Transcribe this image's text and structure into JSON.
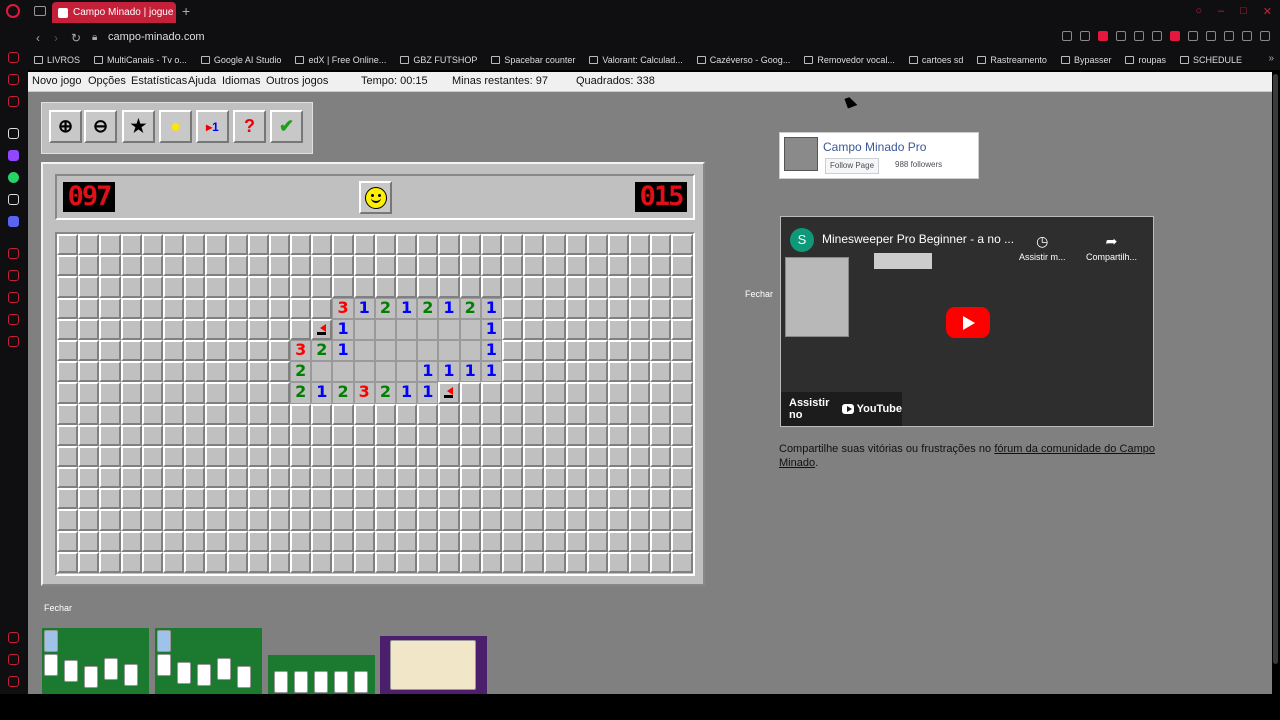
{
  "browser": {
    "tab_title": "Campo Minado | jogue on",
    "url": "campo-minado.com",
    "new_tab_symbol": "+",
    "bookmarks": [
      "LIVROS",
      "MultiCanais - Tv o...",
      "Google AI Studio",
      "edX | Free Online...",
      "GBZ FUTSHOP",
      "Spacebar counter",
      "Valorant: Calculad...",
      "Cazéverso - Goog...",
      "Removedor vocal...",
      "cartoes sd",
      "Rastreamento",
      "Bypasser",
      "roupas",
      "SCHEDULE"
    ]
  },
  "menu": {
    "items": [
      "Novo jogo",
      "Opções",
      "Estatísticas",
      "Ajuda",
      "Idiomas",
      "Outros jogos"
    ],
    "time_label": "Tempo: 00:15",
    "mines_label": "Minas restantes: 97",
    "squares_label": "Quadrados: 338"
  },
  "toolbar": {
    "icons": [
      "zoom-in-icon",
      "zoom-out-icon",
      "star-icon",
      "hint-bulb-icon",
      "flag-number-icon",
      "question-icon",
      "check-icon"
    ]
  },
  "game": {
    "mine_counter": "097",
    "timer": "015",
    "rows": 16,
    "cols": 30,
    "revealed": [
      {
        "r": 3,
        "c": 13,
        "v": "3"
      },
      {
        "r": 3,
        "c": 14,
        "v": "1"
      },
      {
        "r": 3,
        "c": 15,
        "v": "2"
      },
      {
        "r": 3,
        "c": 16,
        "v": "1"
      },
      {
        "r": 3,
        "c": 17,
        "v": "2"
      },
      {
        "r": 3,
        "c": 18,
        "v": "1"
      },
      {
        "r": 3,
        "c": 19,
        "v": "2"
      },
      {
        "r": 3,
        "c": 20,
        "v": "1"
      },
      {
        "r": 4,
        "c": 12,
        "v": "F"
      },
      {
        "r": 4,
        "c": 13,
        "v": "1"
      },
      {
        "r": 4,
        "c": 14,
        "v": ""
      },
      {
        "r": 4,
        "c": 15,
        "v": ""
      },
      {
        "r": 4,
        "c": 16,
        "v": ""
      },
      {
        "r": 4,
        "c": 17,
        "v": ""
      },
      {
        "r": 4,
        "c": 18,
        "v": ""
      },
      {
        "r": 4,
        "c": 19,
        "v": ""
      },
      {
        "r": 4,
        "c": 20,
        "v": "1"
      },
      {
        "r": 5,
        "c": 11,
        "v": "3"
      },
      {
        "r": 5,
        "c": 12,
        "v": "2"
      },
      {
        "r": 5,
        "c": 13,
        "v": "1"
      },
      {
        "r": 5,
        "c": 14,
        "v": ""
      },
      {
        "r": 5,
        "c": 15,
        "v": ""
      },
      {
        "r": 5,
        "c": 16,
        "v": ""
      },
      {
        "r": 5,
        "c": 17,
        "v": ""
      },
      {
        "r": 5,
        "c": 18,
        "v": ""
      },
      {
        "r": 5,
        "c": 19,
        "v": ""
      },
      {
        "r": 5,
        "c": 20,
        "v": "1"
      },
      {
        "r": 6,
        "c": 11,
        "v": "2"
      },
      {
        "r": 6,
        "c": 12,
        "v": ""
      },
      {
        "r": 6,
        "c": 13,
        "v": ""
      },
      {
        "r": 6,
        "c": 14,
        "v": ""
      },
      {
        "r": 6,
        "c": 15,
        "v": ""
      },
      {
        "r": 6,
        "c": 16,
        "v": ""
      },
      {
        "r": 6,
        "c": 17,
        "v": "1"
      },
      {
        "r": 6,
        "c": 18,
        "v": "1"
      },
      {
        "r": 6,
        "c": 19,
        "v": "1"
      },
      {
        "r": 6,
        "c": 20,
        "v": "1"
      },
      {
        "r": 7,
        "c": 11,
        "v": "2"
      },
      {
        "r": 7,
        "c": 12,
        "v": "1"
      },
      {
        "r": 7,
        "c": 13,
        "v": "2"
      },
      {
        "r": 7,
        "c": 14,
        "v": "3"
      },
      {
        "r": 7,
        "c": 15,
        "v": "2"
      },
      {
        "r": 7,
        "c": 16,
        "v": "1"
      },
      {
        "r": 7,
        "c": 17,
        "v": "1"
      },
      {
        "r": 7,
        "c": 18,
        "v": "F"
      }
    ]
  },
  "facebook": {
    "page_name": "Campo Minado Pro",
    "follow_label": "Follow Page",
    "followers": "988 followers"
  },
  "youtube": {
    "close_label": "Fechar",
    "avatar_letter": "S",
    "title": "Minesweeper Pro Beginner - a no ...",
    "watch_later": "Assistir m...",
    "share": "Compartilh...",
    "watch_on": "Assistir no",
    "yt_brand": "YouTube"
  },
  "share_text": {
    "prefix": "Compartilhe suas vitórias ou frustrações no ",
    "link": "fórum da comunidade do Campo Minado",
    "suffix": "."
  },
  "bottom": {
    "close_label": "Fechar"
  },
  "colors": {
    "n1": "#0000ff",
    "n2": "#008000",
    "n3": "#ff0000",
    "accent": "#c5203a"
  }
}
